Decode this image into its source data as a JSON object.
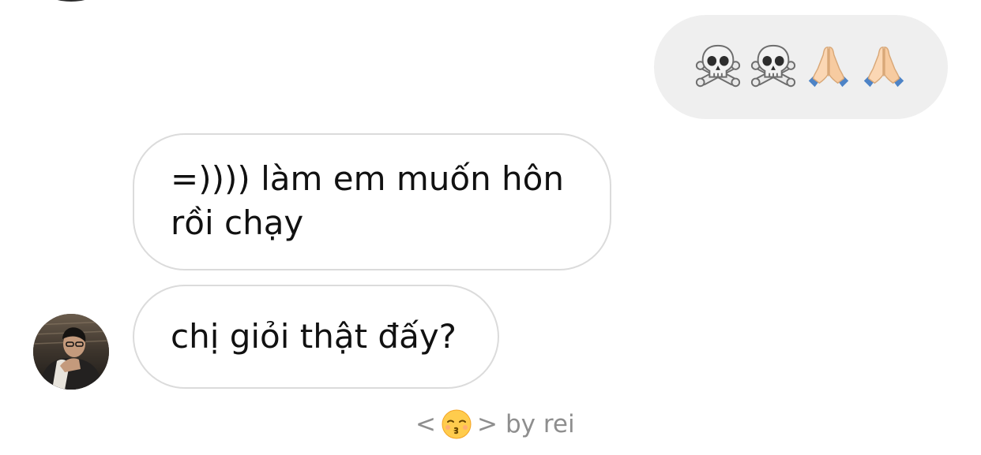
{
  "thread": {
    "sent_message": {
      "emojis": [
        "skull-and-crossbones-icon",
        "skull-and-crossbones-icon",
        "folded-hands-icon",
        "folded-hands-icon"
      ]
    },
    "received_messages": [
      {
        "text_line1": "=)))) làm em muốn hôn",
        "text_line2": "rồi chạy"
      },
      {
        "text": "chị giỏi thật đấy?"
      }
    ]
  },
  "footer": {
    "open": "<",
    "emoji": "kissing-face-icon",
    "close": ">",
    "credit": "by rei"
  },
  "colors": {
    "sent_bubble": "#efefef",
    "received_border": "#dbdbdb",
    "footer_text": "#8e8e8e",
    "message_text": "#111111"
  }
}
